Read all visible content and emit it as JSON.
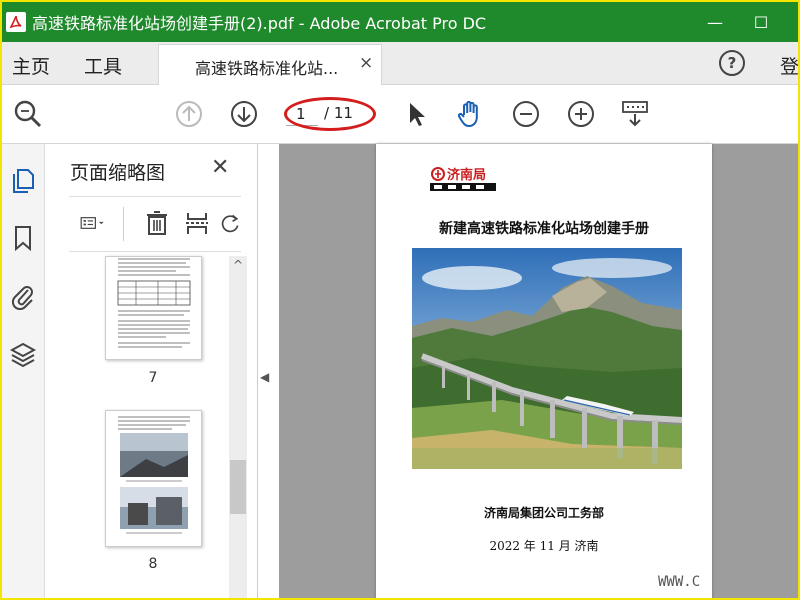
{
  "window": {
    "title": "高速铁路标准化站场创建手册(2).pdf - Adobe Acrobat Pro DC",
    "minimize_glyph": "—",
    "maximize_glyph": "☐"
  },
  "tabs": {
    "home": "主页",
    "tools": "工具",
    "document_tab": "高速铁路标准化站...",
    "close_glyph": "×",
    "help_glyph": "?",
    "signin": "登"
  },
  "toolbar": {
    "page_current": "1",
    "page_total": "/ 11"
  },
  "thumbnail_panel": {
    "title": "页面缩略图",
    "close_glyph": "✕",
    "pages": [
      {
        "label": "7"
      },
      {
        "label": "8"
      }
    ]
  },
  "document": {
    "logo_text": "济南局",
    "title": "新建高速铁路标准化站场创建手册",
    "organization": "济南局集团公司工务部",
    "date": "2022 年 11 月  济南"
  },
  "watermark": "WWW.C",
  "colors": {
    "titlebar": "#1f8a2c",
    "annotation_ellipse": "#d41d1d",
    "icon_blue": "#1a5fb4",
    "document_bg": "#9d9d9d"
  }
}
